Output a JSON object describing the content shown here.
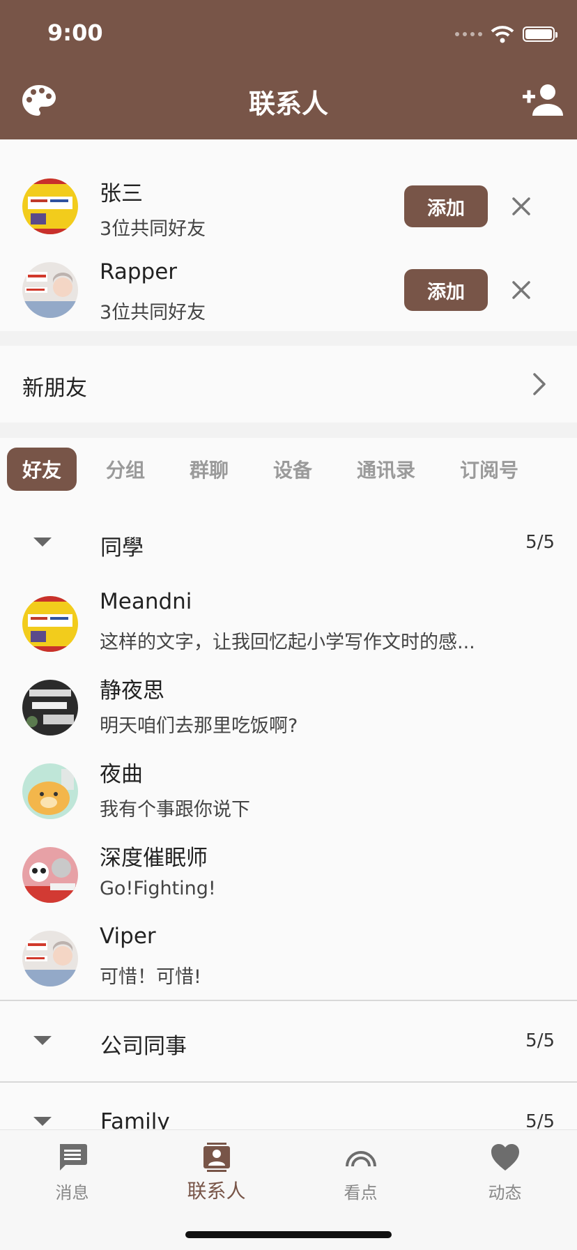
{
  "status": {
    "time": "9:00"
  },
  "header": {
    "title": "联系人",
    "left_icon": "palette-icon",
    "right_icon": "add-person-icon"
  },
  "requests": [
    {
      "name": "张三",
      "sub": "3位共同好友",
      "button": "添加"
    },
    {
      "name": "Rapper",
      "sub": "3位共同好友",
      "button": "添加"
    }
  ],
  "new_friends": {
    "label": "新朋友"
  },
  "tabs": [
    "好友",
    "分组",
    "群聊",
    "设备",
    "通讯录",
    "订阅号"
  ],
  "groups": [
    {
      "name": "同學",
      "count": "5/5"
    },
    {
      "name": "公司同事",
      "count": "5/5"
    },
    {
      "name": "Family",
      "count": "5/5"
    }
  ],
  "contacts": [
    {
      "name": "Meandni",
      "sub": "这样的文字，让我回忆起小学写作文时的感..."
    },
    {
      "name": "静夜思",
      "sub": "明天咱们去那里吃饭啊?"
    },
    {
      "name": "夜曲",
      "sub": "我有个事跟你说下"
    },
    {
      "name": "深度催眠师",
      "sub": "Go!Fighting!"
    },
    {
      "name": "Viper",
      "sub": "可惜！可惜!"
    }
  ],
  "nav": [
    {
      "label": "消息",
      "icon": "message-icon"
    },
    {
      "label": "联系人",
      "icon": "contacts-icon"
    },
    {
      "label": "看点",
      "icon": "rainbow-icon"
    },
    {
      "label": "动态",
      "icon": "heart-icon"
    }
  ],
  "colors": {
    "accent": "#785548",
    "background": "#fafafa"
  }
}
